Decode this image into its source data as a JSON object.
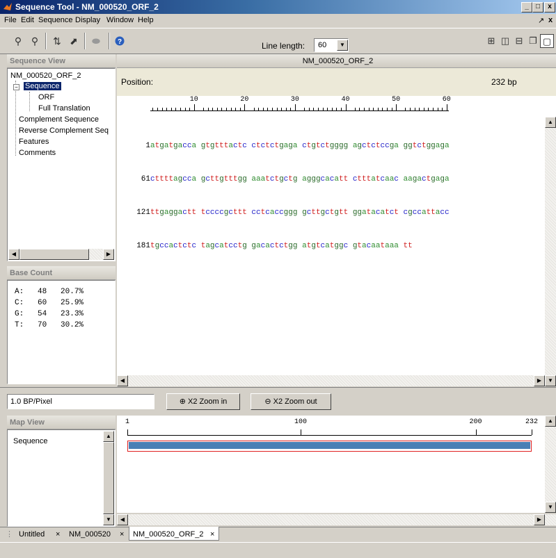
{
  "window": {
    "title": "Sequence Tool - NM_000520_ORF_2",
    "minimize": "_",
    "maximize": "□",
    "close": "x"
  },
  "menu": [
    "File",
    "Edit",
    "Sequence",
    "Display",
    "Window",
    "Help"
  ],
  "menu_right": {
    "undock": "↗",
    "close": "x"
  },
  "toolbar": {
    "line_length_label": "Line length:",
    "line_length_value": "60"
  },
  "sequence_view": {
    "header": "Sequence View",
    "tree": {
      "root": "NM_000520_ORF_2",
      "sequence": "Sequence",
      "orf": "ORF",
      "full_translation": "Full Translation",
      "complement": "Complement Sequence",
      "reverse_complement": "Reverse Complement Seq",
      "features": "Features",
      "comments": "Comments"
    }
  },
  "base_count": {
    "header": "Base Count",
    "rows": [
      {
        "base": "A:",
        "count": "48",
        "pct": "20.7%"
      },
      {
        "base": "C:",
        "count": "60",
        "pct": "25.9%"
      },
      {
        "base": "G:",
        "count": "54",
        "pct": "23.3%"
      },
      {
        "base": "T:",
        "count": "70",
        "pct": "30.2%"
      }
    ]
  },
  "main": {
    "header": "NM_000520_ORF_2",
    "position_label": "Position:",
    "length": "232 bp",
    "ruler_ticks": [
      "10",
      "20",
      "30",
      "40",
      "50",
      "60"
    ],
    "lines": [
      {
        "num": "1",
        "seq": "atgatgacca gtgtttactc ctctctgaga ctgtctgggg agctctccga ggtctggaga"
      },
      {
        "num": "61",
        "seq": "cttttagcca gcttgtttgg aaatctgctg agggcacatt ctttatcaac aagactgaga"
      },
      {
        "num": "121",
        "seq": "ttgaggactt tccccgcttt cctcaccggg gcttgctgtt ggatacatct cgccattacc"
      },
      {
        "num": "181",
        "seq": "tgccactctc tagcatcctg gacactctgg atgtcatggc gtacaataaa tt"
      }
    ]
  },
  "zoom": {
    "value": "1.0 BP/Pixel",
    "zoom_in": "X2 Zoom in",
    "zoom_out": "X2 Zoom out"
  },
  "map_view": {
    "header": "Map View",
    "item": "Sequence",
    "ruler_labels": [
      "1",
      "100",
      "200",
      "232"
    ]
  },
  "tabs": [
    {
      "label": "Untitled",
      "close": "×"
    },
    {
      "label": "NM_000520",
      "close": "×"
    },
    {
      "label": "NM_000520_ORF_2",
      "close": "×"
    }
  ],
  "colors": {
    "a": "#2e8b2e",
    "c": "#2020c8",
    "g": "#2b6b2b",
    "t": "#d02020",
    "map_bar": "#4a7fb5",
    "map_border": "#e02020"
  }
}
